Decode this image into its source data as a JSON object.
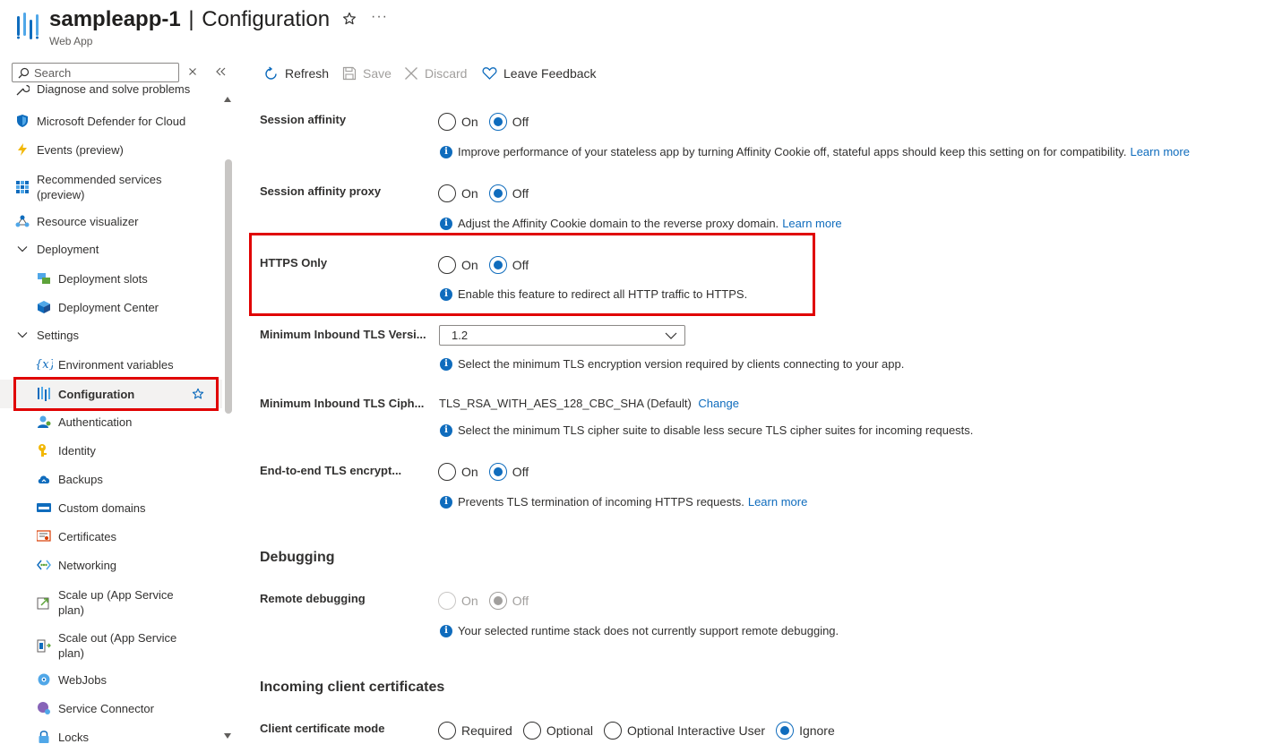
{
  "header": {
    "resource_name": "sampleapp-1",
    "separator": "|",
    "page_name": "Configuration",
    "subtitle": "Web App",
    "more_label": "···"
  },
  "search": {
    "placeholder": "Search"
  },
  "sidebar": {
    "items": [
      {
        "label": "Diagnose and solve problems",
        "icon": "wrench-icon"
      },
      {
        "label": "Microsoft Defender for Cloud",
        "icon": "shield-icon"
      },
      {
        "label": "Events (preview)",
        "icon": "lightning-icon"
      },
      {
        "label": "Recommended services (preview)",
        "icon": "grid-icon"
      },
      {
        "label": "Resource visualizer",
        "icon": "network-icon"
      },
      {
        "label": "Deployment",
        "icon": "chevron-down-icon"
      },
      {
        "label": "Deployment slots",
        "icon": "slots-icon"
      },
      {
        "label": "Deployment Center",
        "icon": "cube-icon"
      },
      {
        "label": "Settings",
        "icon": "chevron-down-icon"
      },
      {
        "label": "Environment variables",
        "icon": "variable-icon"
      },
      {
        "label": "Configuration",
        "icon": "config-bars-icon",
        "selected": true
      },
      {
        "label": "Authentication",
        "icon": "user-icon"
      },
      {
        "label": "Identity",
        "icon": "key-icon"
      },
      {
        "label": "Backups",
        "icon": "cloud-icon"
      },
      {
        "label": "Custom domains",
        "icon": "www-icon"
      },
      {
        "label": "Certificates",
        "icon": "certificate-icon"
      },
      {
        "label": "Networking",
        "icon": "networking-icon"
      },
      {
        "label": "Scale up (App Service plan)",
        "icon": "scale-up-icon"
      },
      {
        "label": "Scale out (App Service plan)",
        "icon": "scale-out-icon"
      },
      {
        "label": "WebJobs",
        "icon": "webjobs-icon"
      },
      {
        "label": "Service Connector",
        "icon": "connector-icon"
      },
      {
        "label": "Locks",
        "icon": "lock-icon"
      }
    ]
  },
  "toolbar": {
    "refresh": "Refresh",
    "save": "Save",
    "discard": "Discard",
    "feedback": "Leave Feedback"
  },
  "settings": {
    "session_affinity": {
      "label": "Session affinity",
      "on": "On",
      "off": "Off",
      "selected": "Off",
      "info": "Improve performance of your stateless app by turning Affinity Cookie off, stateful apps should keep this setting on for compatibility.",
      "link": "Learn more"
    },
    "session_affinity_proxy": {
      "label": "Session affinity proxy",
      "on": "On",
      "off": "Off",
      "selected": "Off",
      "info": "Adjust the Affinity Cookie domain to the reverse proxy domain.",
      "link": "Learn more"
    },
    "https_only": {
      "label": "HTTPS Only",
      "on": "On",
      "off": "Off",
      "selected": "Off",
      "info": "Enable this feature to redirect all HTTP traffic to HTTPS."
    },
    "min_tls_version": {
      "label": "Minimum Inbound TLS Versi...",
      "value": "1.2",
      "info": "Select the minimum TLS encryption version required by clients connecting to your app."
    },
    "min_tls_cipher": {
      "label": "Minimum Inbound TLS Ciph...",
      "value": "TLS_RSA_WITH_AES_128_CBC_SHA (Default)",
      "link": "Change",
      "info": "Select the minimum TLS cipher suite to disable less secure TLS cipher suites for incoming requests."
    },
    "e2e_tls": {
      "label": "End-to-end TLS encrypt...",
      "on": "On",
      "off": "Off",
      "selected": "Off",
      "info": "Prevents TLS termination of incoming HTTPS requests.",
      "link": "Learn more"
    },
    "debugging_heading": "Debugging",
    "remote_debugging": {
      "label": "Remote debugging",
      "on": "On",
      "off": "Off",
      "selected": "Off",
      "disabled": true,
      "info": "Your selected runtime stack does not currently support remote debugging."
    },
    "client_certs_heading": "Incoming client certificates",
    "client_cert_mode": {
      "label": "Client certificate mode",
      "options": [
        "Required",
        "Optional",
        "Optional Interactive User",
        "Ignore"
      ],
      "selected": "Ignore"
    }
  },
  "colors": {
    "accent": "#0f6cbd",
    "highlight": "#e00000"
  }
}
